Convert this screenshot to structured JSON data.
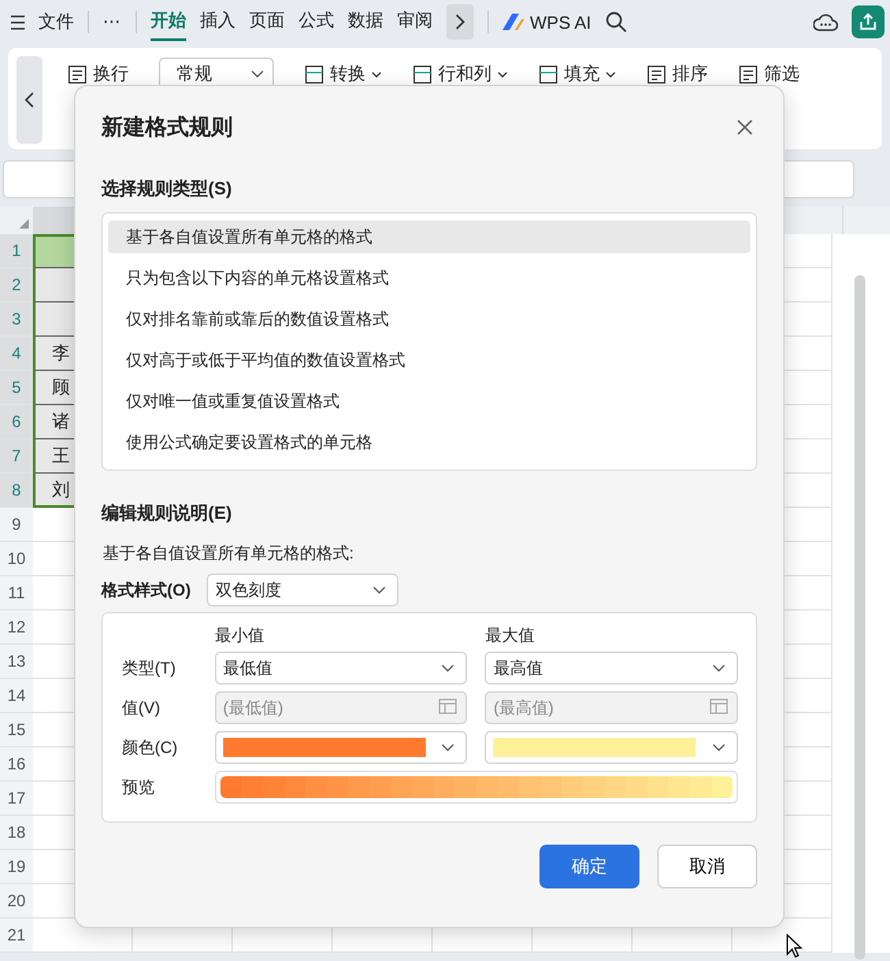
{
  "menu_bar": {
    "file": "文件",
    "more": "⋯",
    "tabs": [
      {
        "label": "开始",
        "selected": true
      },
      {
        "label": "插入",
        "selected": false
      },
      {
        "label": "页面",
        "selected": false
      },
      {
        "label": "公式",
        "selected": false
      },
      {
        "label": "数据",
        "selected": false
      },
      {
        "label": "审阅",
        "selected": false
      }
    ],
    "ai_label": "WPS AI"
  },
  "ribbon": {
    "items": [
      {
        "label": "换行",
        "kind": "button"
      },
      {
        "label": "常规",
        "kind": "dropdown"
      },
      {
        "label": "转换",
        "kind": "menu"
      },
      {
        "label": "行和列",
        "kind": "menu"
      },
      {
        "label": "填充",
        "kind": "menu"
      },
      {
        "label": "排序",
        "kind": "button"
      },
      {
        "label": "筛选",
        "kind": "button"
      }
    ]
  },
  "sheet": {
    "rows": [
      {
        "number": "1",
        "selected": true,
        "header": true
      },
      {
        "number": "2",
        "selected": true,
        "header": false
      },
      {
        "number": "3",
        "selected": true,
        "header": false
      },
      {
        "number": "4",
        "selected": true,
        "header": false,
        "cell": "李"
      },
      {
        "number": "5",
        "selected": true,
        "header": false,
        "cell": "顾"
      },
      {
        "number": "6",
        "selected": true,
        "header": false,
        "cell": "诸"
      },
      {
        "number": "7",
        "selected": true,
        "header": false,
        "cell": "王"
      },
      {
        "number": "8",
        "selected": true,
        "header": false,
        "cell": "刘"
      },
      {
        "number": "9",
        "selected": false,
        "header": false
      },
      {
        "number": "10",
        "selected": false,
        "header": false
      },
      {
        "number": "11",
        "selected": false,
        "header": false
      },
      {
        "number": "12",
        "selected": false,
        "header": false
      },
      {
        "number": "13",
        "selected": false,
        "header": false
      },
      {
        "number": "14",
        "selected": false,
        "header": false
      },
      {
        "number": "15",
        "selected": false,
        "header": false
      },
      {
        "number": "16",
        "selected": false,
        "header": false
      },
      {
        "number": "17",
        "selected": false,
        "header": false
      },
      {
        "number": "18",
        "selected": false,
        "header": false
      },
      {
        "number": "19",
        "selected": false,
        "header": false
      },
      {
        "number": "20",
        "selected": false,
        "header": false
      },
      {
        "number": "21",
        "selected": false,
        "header": false
      }
    ]
  },
  "dialog": {
    "title": "新建格式规则",
    "rule_type_label": "选择规则类型(S)",
    "rule_types": [
      {
        "label": "基于各自值设置所有单元格的格式",
        "selected": true
      },
      {
        "label": "只为包含以下内容的单元格设置格式",
        "selected": false
      },
      {
        "label": "仅对排名靠前或靠后的数值设置格式",
        "selected": false
      },
      {
        "label": "仅对高于或低于平均值的数值设置格式",
        "selected": false
      },
      {
        "label": "仅对唯一值或重复值设置格式",
        "selected": false
      },
      {
        "label": "使用公式确定要设置格式的单元格",
        "selected": false
      }
    ],
    "edit_label": "编辑规则说明(E)",
    "description": "基于各自值设置所有单元格的格式:",
    "format_style": {
      "label": "格式样式(O)",
      "value": "双色刻度"
    },
    "scale": {
      "min_heading": "最小值",
      "max_heading": "最大值",
      "type": {
        "label": "类型(T)",
        "min": "最低值",
        "max": "最高值"
      },
      "value": {
        "label": "值(V)",
        "min_placeholder": "(最低值)",
        "max_placeholder": "(最高值)"
      },
      "color": {
        "label": "颜色(C)",
        "swatches": [
          {
            "color": "#ff7a2f"
          },
          {
            "color": "#fff09a"
          }
        ]
      },
      "preview": {
        "label": "预览"
      }
    },
    "buttons": [
      {
        "label": "确定",
        "kind": "primary"
      },
      {
        "label": "取消",
        "kind": "secondary"
      }
    ]
  }
}
